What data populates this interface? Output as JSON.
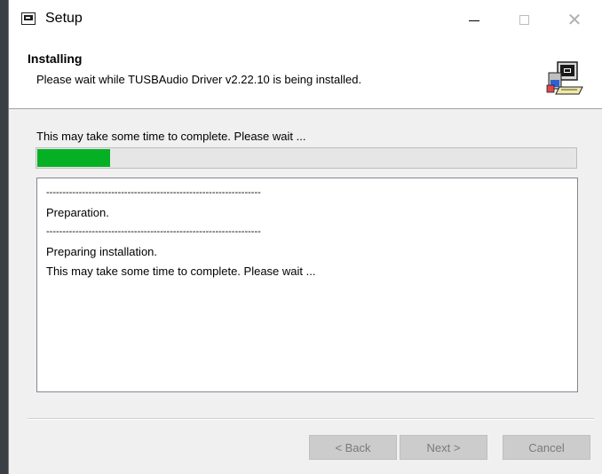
{
  "window": {
    "title": "Setup"
  },
  "header": {
    "title": "Installing",
    "subtitle": "Please wait while TUSBAudio Driver v2.22.10 is being installed."
  },
  "status_text": "This may take some time to complete. Please wait ...",
  "progress": {
    "percent": 13.5,
    "color": "#06b025"
  },
  "log": {
    "lines": [
      "------------------------------------------------------------------",
      "Preparation.",
      "------------------------------------------------------------------",
      "Preparing installation.",
      "This may take some time to complete. Please wait ..."
    ]
  },
  "buttons": {
    "back": "< Back",
    "next": "Next >",
    "cancel": "Cancel"
  }
}
